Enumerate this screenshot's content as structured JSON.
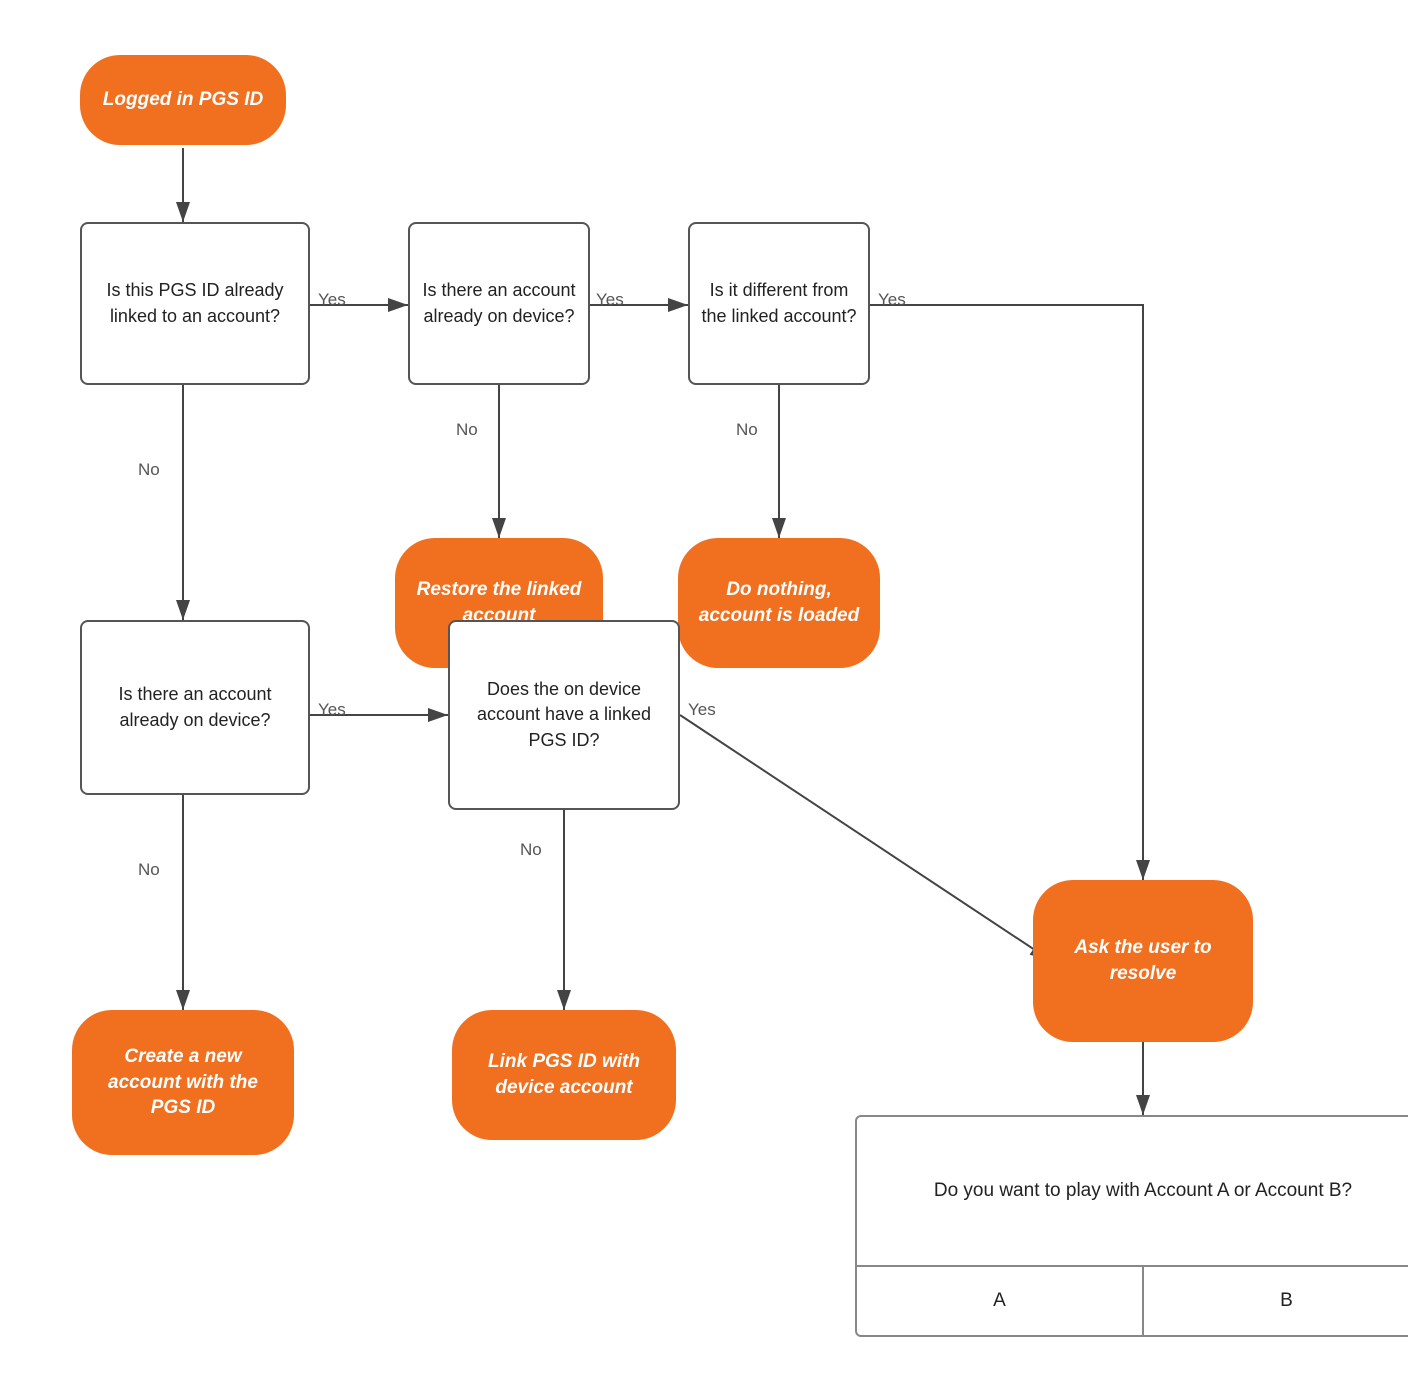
{
  "nodes": {
    "start": {
      "label": "Logged in PGS ID"
    },
    "q1": {
      "label": "Is this PGS ID already linked to an account?"
    },
    "q2": {
      "label": "Is there an account already on device?"
    },
    "q3": {
      "label": "Is it different from the linked account?"
    },
    "r_restore": {
      "label": "Restore the linked account"
    },
    "r_donothing": {
      "label": "Do nothing, account is loaded"
    },
    "q4": {
      "label": "Is there an account already on device?"
    },
    "q5": {
      "label": "Does the on device account have a linked PGS ID?"
    },
    "r_create": {
      "label": "Create a new account with the PGS ID"
    },
    "r_link": {
      "label": "Link PGS ID with device account"
    },
    "r_ask": {
      "label": "Ask the user to resolve"
    },
    "dialog_question": {
      "label": "Do you want to play with Account A or Account B?"
    },
    "dialog_a": {
      "label": "A"
    },
    "dialog_b": {
      "label": "B"
    }
  },
  "labels": {
    "yes1": "Yes",
    "yes2": "Yes",
    "yes3": "Yes",
    "yes4": "Yes",
    "yes5": "Yes",
    "no1": "No",
    "no2": "No",
    "no3": "No",
    "no4": "No"
  },
  "colors": {
    "orange": "#f07020",
    "arrow": "#444",
    "box_border": "#555"
  }
}
